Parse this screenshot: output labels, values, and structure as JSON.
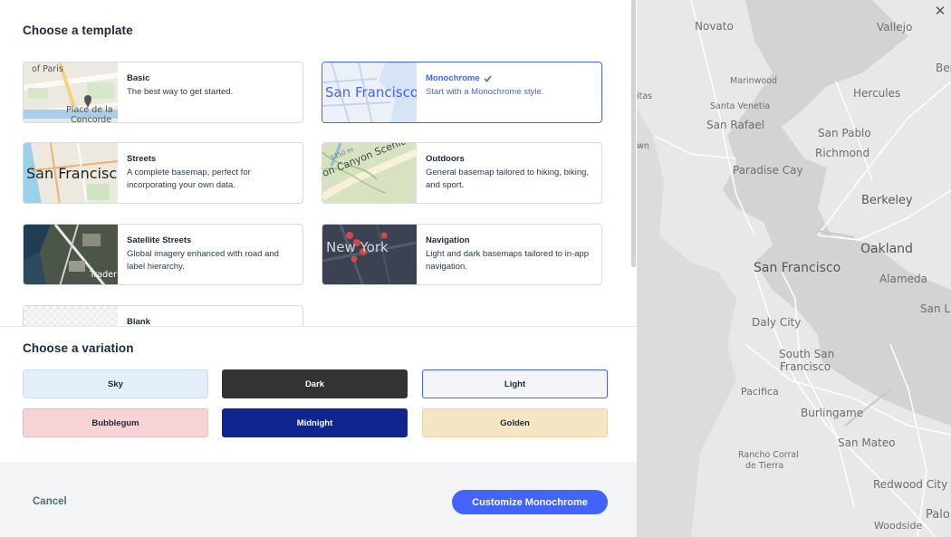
{
  "template_section": {
    "title": "Choose a template"
  },
  "templates": [
    {
      "name": "Basic",
      "desc": "The best way to get started.",
      "thumb_labels": [
        "of Paris",
        "Place de la",
        "Concorde"
      ]
    },
    {
      "name": "Monochrome",
      "desc": "Start with a Monochrome style.",
      "thumb_labels": [
        "San Francisco"
      ],
      "selected": true,
      "check_icon": "checkmark-icon"
    },
    {
      "name": "Streets",
      "desc": "A complete basemap, perfect for incorporating your own data.",
      "thumb_labels": [
        "San Francisco"
      ]
    },
    {
      "name": "Outdoors",
      "desc": "General basemap tailored to hiking, biking, and sport.",
      "thumb_labels": [
        "on Canyon Scenic Dr",
        "1350 m"
      ]
    },
    {
      "name": "Satellite Streets",
      "desc": "Global imagery enhanced with road and label hierarchy.",
      "thumb_labels": [
        "Trader J"
      ]
    },
    {
      "name": "Navigation",
      "desc": "Light and dark basemaps tailored to in-app navigation.",
      "thumb_labels": [
        "New York"
      ]
    },
    {
      "name": "Blank",
      "desc": "",
      "thumb_labels": []
    }
  ],
  "variation_section": {
    "title": "Choose a variation"
  },
  "variations": [
    {
      "label": "Sky",
      "bg": "#e2eefb",
      "border": "#c9dcf2",
      "color": "#1b2a3a"
    },
    {
      "label": "Dark",
      "bg": "#333333",
      "border": "#333333",
      "color": "#ffffff"
    },
    {
      "label": "Light",
      "bg": "#f4f5f6",
      "border": "#4264fb",
      "color": "#1b2a3a",
      "selected": true
    },
    {
      "label": "Bubblegum",
      "bg": "#f6d3d5",
      "border": "#efb9bd",
      "color": "#1b2a3a"
    },
    {
      "label": "Midnight",
      "bg": "#0f2690",
      "border": "#0f2690",
      "color": "#ffffff"
    },
    {
      "label": "Golden",
      "bg": "#f5e6c3",
      "border": "#ecd6a5",
      "color": "#1b2a3a"
    }
  ],
  "footer": {
    "cancel_label": "Cancel",
    "cta_label": "Customize Monochrome"
  },
  "map_preview": {
    "close_icon": "close-icon",
    "labels": [
      "Novato",
      "Vallejo",
      "Ber",
      "Marinwood",
      "itas",
      "Hercules",
      "Santa Venetia",
      "San Rafael",
      "San Pablo",
      "Richmond",
      "wn",
      "Paradise Cay",
      "Berkeley",
      "Oakland",
      "San Francisco",
      "Alameda",
      "San L",
      "Daly City",
      "South San",
      "Francisco",
      "Pacifica",
      "Burlingame",
      "San Mateo",
      "Rancho Corral",
      "de Tierra",
      "Redwood City",
      "Palo",
      "Woodside"
    ]
  },
  "colors": {
    "accent": "#4264fb",
    "text": "#1b2a3a",
    "footer_bg": "#f4f5f7"
  }
}
